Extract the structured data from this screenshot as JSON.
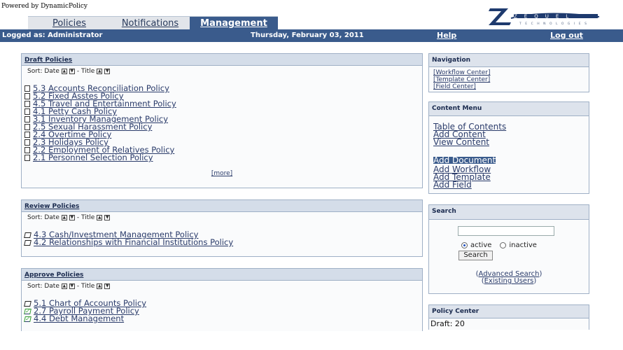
{
  "powered_by": "Powered by DynamicPolicy",
  "tabs": [
    {
      "label": "Policies"
    },
    {
      "label": "Notifications"
    },
    {
      "label": "Management"
    }
  ],
  "logo_text": "ZEQUEL",
  "logo_sub": "TECHNOLOGIES",
  "bar": {
    "logged": "Logged as: Administrator",
    "date": "Thursday, February 03, 2011",
    "help": "Help",
    "logout": "Log out"
  },
  "sort": {
    "label_date": "Sort: Date",
    "label_title": "- Title"
  },
  "draft": {
    "title": "Draft Policies",
    "items": [
      "5.3 Accounts Reconciliation Policy",
      "5.2 Fixed Asstes Policy",
      "4.5 Travel and Entertainment Policy",
      "4.1 Petty Cash Policy",
      "3.1 Inventory Management Policy",
      "2.5 Sexual Harassment Policy",
      "2.4 Overtime Policy",
      "2.3 Holidays Policy",
      "2.2 Employment of Relatives Policy",
      "2.1 Personnel Selection Policy"
    ],
    "more": "[more]"
  },
  "review": {
    "title": "Review Policies",
    "items": [
      "4.3 Cash/Investment Management Policy",
      "4.2 Relationships with Financial Institutions Policy"
    ]
  },
  "approve": {
    "title": "Approve Policies",
    "items": [
      {
        "label": "5.1 Chart of Accounts Policy",
        "checked": false
      },
      {
        "label": "2.7 Payroll Payment Policy",
        "checked": true
      },
      {
        "label": "4.4 Debt Management",
        "checked": true
      }
    ]
  },
  "navigation": {
    "title": "Navigation",
    "links": [
      "[Workflow Center]",
      "[Template Center]",
      "[Field Center]"
    ]
  },
  "content_menu": {
    "title": "Content Menu",
    "group1": [
      "Table of Contents",
      "Add Content",
      "View Content"
    ],
    "group2": [
      "Add Document",
      "Add Workflow",
      "Add Template",
      "Add Field"
    ]
  },
  "search": {
    "title": "Search",
    "active": "active",
    "inactive": "inactive",
    "button": "Search",
    "advanced": "Advanced Search",
    "existing": "Existing Users"
  },
  "policy_center": {
    "title": "Policy Center",
    "draft": "Draft: 20"
  },
  "colors": {
    "accent": "#3a5b8c",
    "panel_head": "#d4dde9",
    "link": "#2a3b6a"
  }
}
